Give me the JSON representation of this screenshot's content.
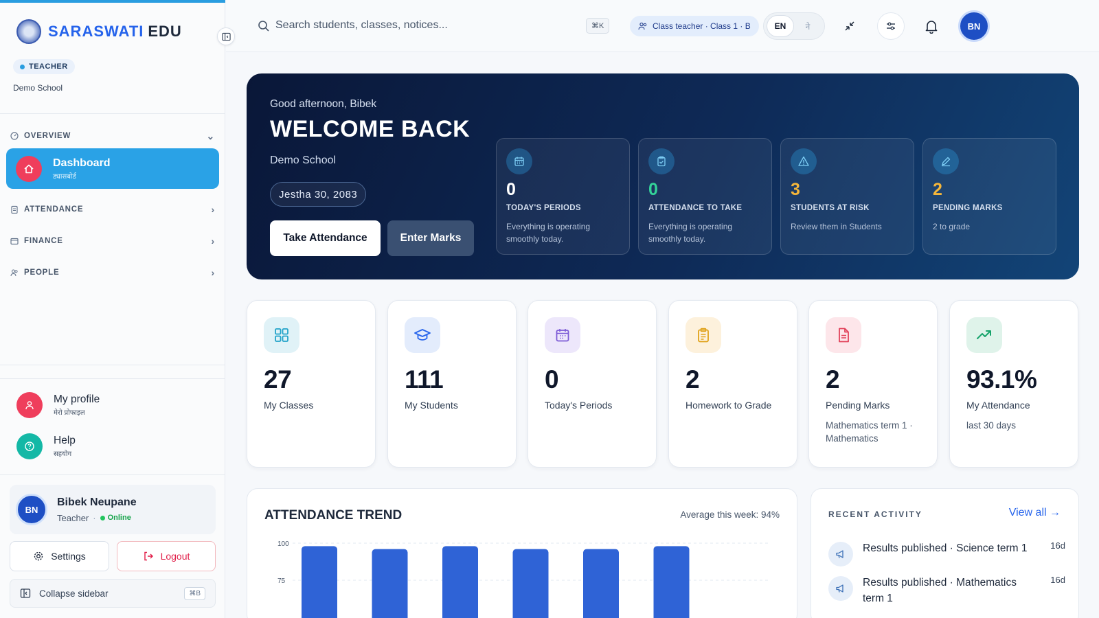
{
  "brand": {
    "name_a": "SARASWATI",
    "name_b": "EDU"
  },
  "sidebar": {
    "role_badge": "TEACHER",
    "school": "Demo School",
    "sections": [
      {
        "label": "OVERVIEW",
        "icon": "gauge-icon"
      },
      {
        "label": "ATTENDANCE",
        "icon": "clipboard-icon"
      },
      {
        "label": "FINANCE",
        "icon": "wallet-icon"
      },
      {
        "label": "PEOPLE",
        "icon": "users-icon"
      }
    ],
    "active_item": {
      "label": "Dashboard",
      "sub": "ड्यासबोर्ड",
      "icon": "home-icon"
    },
    "profile": {
      "label": "My profile",
      "sub": "मेरो प्रोफाइल"
    },
    "help": {
      "label": "Help",
      "sub": "सहयोग"
    },
    "user": {
      "initials": "BN",
      "name": "Bibek Neupane",
      "role": "Teacher",
      "status": "Online"
    },
    "settings_label": "Settings",
    "logout_label": "Logout",
    "collapse_label": "Collapse sidebar",
    "collapse_kbd": "⌘B"
  },
  "header": {
    "search_placeholder": "Search students, classes, notices...",
    "search_kbd": "⌘K",
    "context": "Class teacher · Class 1 · B",
    "lang_en": "EN",
    "lang_ne": "ने",
    "avatar": "BN"
  },
  "hero": {
    "greeting": "Good afternoon, Bibek",
    "title": "WELCOME BACK",
    "school": "Demo School",
    "date": "Jestha 30, 2083",
    "btn_attendance": "Take Attendance",
    "btn_marks": "Enter Marks",
    "stats": [
      {
        "value": "0",
        "label": "TODAY'S PERIODS",
        "sub": "Everything is operating smoothly today.",
        "icon": "calendar-icon",
        "color": "#ffffff"
      },
      {
        "value": "0",
        "label": "ATTENDANCE TO TAKE",
        "sub": "Everything is operating smoothly today.",
        "icon": "clipboard-check-icon",
        "color": "#34d399"
      },
      {
        "value": "3",
        "label": "STUDENTS AT RISK",
        "sub": "Review them in Students",
        "icon": "warning-icon",
        "color": "#f5b63a"
      },
      {
        "value": "2",
        "label": "PENDING MARKS",
        "sub": "2 to grade",
        "icon": "pencil-icon",
        "color": "#f5b63a"
      }
    ]
  },
  "cards": [
    {
      "value": "27",
      "label": "My Classes",
      "sub": "",
      "icon": "grid-icon",
      "bg": "#e0f2f7",
      "fg": "#22a3c9"
    },
    {
      "value": "111",
      "label": "My Students",
      "sub": "",
      "icon": "graduation-cap-icon",
      "bg": "#e3ecfc",
      "fg": "#2563eb"
    },
    {
      "value": "0",
      "label": "Today's Periods",
      "sub": "",
      "icon": "calendar-icon",
      "bg": "#ede7fb",
      "fg": "#7c5ad6"
    },
    {
      "value": "2",
      "label": "Homework to Grade",
      "sub": "",
      "icon": "clipboard-icon",
      "bg": "#fdf1dc",
      "fg": "#e0a21a"
    },
    {
      "value": "2",
      "label": "Pending Marks",
      "sub": "Mathematics term 1 · Mathematics",
      "icon": "document-icon",
      "bg": "#fde6ea",
      "fg": "#e2445c"
    },
    {
      "value": "93.1%",
      "label": "My Attendance",
      "sub": "last 30 days",
      "icon": "trending-up-icon",
      "bg": "#dff3ea",
      "fg": "#16a36b"
    }
  ],
  "trend": {
    "title": "ATTENDANCE TREND",
    "average": "Average this week: 94%"
  },
  "chart_data": {
    "type": "bar",
    "title": "ATTENDANCE TREND",
    "categories": [
      "",
      "",
      "",
      "",
      "",
      ""
    ],
    "values": [
      98,
      96,
      98,
      96,
      96,
      98
    ],
    "ylim": [
      50,
      100
    ],
    "yticks": [
      "100",
      "75"
    ],
    "grid": true,
    "color": "#2f63d6"
  },
  "activity": {
    "title": "RECENT ACTIVITY",
    "view_all": "View all →",
    "items": [
      {
        "text": "Results published · Science term 1",
        "time": "16d",
        "icon": "megaphone-icon"
      },
      {
        "text": "Results published · Mathematics term 1",
        "time": "16d",
        "icon": "megaphone-icon"
      }
    ]
  }
}
